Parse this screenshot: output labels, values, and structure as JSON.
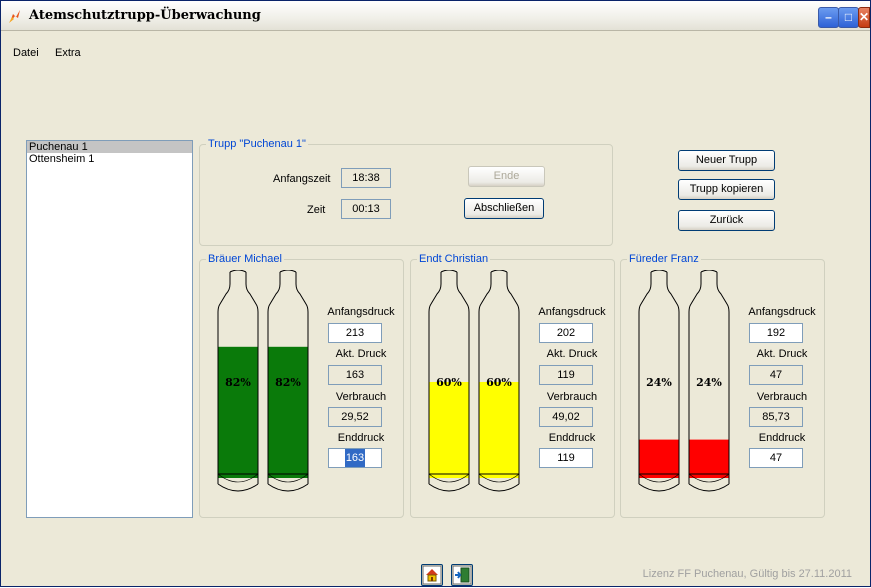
{
  "window": {
    "title": "Atemschutztrupp-Überwachung"
  },
  "menu": {
    "items": [
      "Datei",
      "Extra"
    ]
  },
  "trupp_list": {
    "items": [
      "Puchenau 1",
      "Ottensheim 1"
    ],
    "selected_index": 0
  },
  "trupp_group": {
    "title": "Trupp \"Puchenau 1\"",
    "start_label": "Anfangszeit",
    "start_value": "18:38",
    "time_label": "Zeit",
    "time_value": "00:13",
    "end_button": "Ende",
    "finish_button": "Abschließen"
  },
  "actions": {
    "new_trupp": "Neuer Trupp",
    "copy_trupp": "Trupp kopieren",
    "back": "Zurück"
  },
  "field_labels": {
    "start_pressure": "Anfangsdruck",
    "current_pressure": "Akt. Druck",
    "consumption": "Verbrauch",
    "end_pressure": "Enddruck"
  },
  "members": [
    {
      "name": "Bräuer Michael",
      "percent_label": "82%",
      "fill_fraction": 0.82,
      "fill_color": "#0a7a0a",
      "start_pressure": "213",
      "current_pressure": "163",
      "consumption": "29,52",
      "end_pressure": "163"
    },
    {
      "name": "Endt Christian",
      "percent_label": "60%",
      "fill_fraction": 0.6,
      "fill_color": "#ffff00",
      "start_pressure": "202",
      "current_pressure": "119",
      "consumption": "49,02",
      "end_pressure": "119"
    },
    {
      "name": "Füreder Franz",
      "percent_label": "24%",
      "fill_fraction": 0.24,
      "fill_color": "#ff0000",
      "start_pressure": "192",
      "current_pressure": "47",
      "consumption": "85,73",
      "end_pressure": "47"
    }
  ],
  "footer": {
    "license": "Lizenz FF Puchenau, Gültig bis 27.11.2011",
    "home_icon": "home-icon",
    "exit_icon": "exit-door-icon"
  }
}
